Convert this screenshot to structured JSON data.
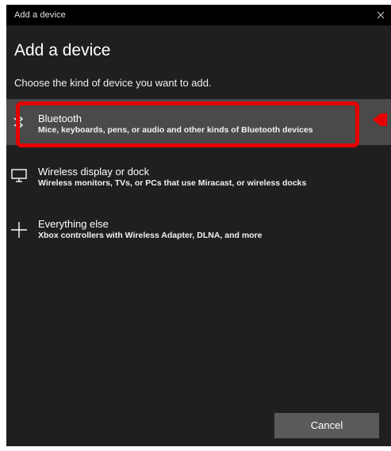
{
  "window": {
    "title": "Add a device",
    "close_icon": "close-icon"
  },
  "heading": "Add a device",
  "subheading": "Choose the kind of device you want to add.",
  "options": [
    {
      "icon": "bluetooth-icon",
      "title": "Bluetooth",
      "description": "Mice, keyboards, pens, or audio and other kinds of Bluetooth devices",
      "selected": true
    },
    {
      "icon": "monitor-icon",
      "title": "Wireless display or dock",
      "description": "Wireless monitors, TVs, or PCs that use Miracast, or wireless docks",
      "selected": false
    },
    {
      "icon": "plus-icon",
      "title": "Everything else",
      "description": "Xbox controllers with Wireless Adapter, DLNA, and more",
      "selected": false
    }
  ],
  "buttons": {
    "cancel_label": "Cancel"
  },
  "colors": {
    "background": "#1f1f1f",
    "titlebar": "#000000",
    "selected_row": "#4a4a4a",
    "highlight": "#e60000",
    "button": "#5a5a5a"
  }
}
